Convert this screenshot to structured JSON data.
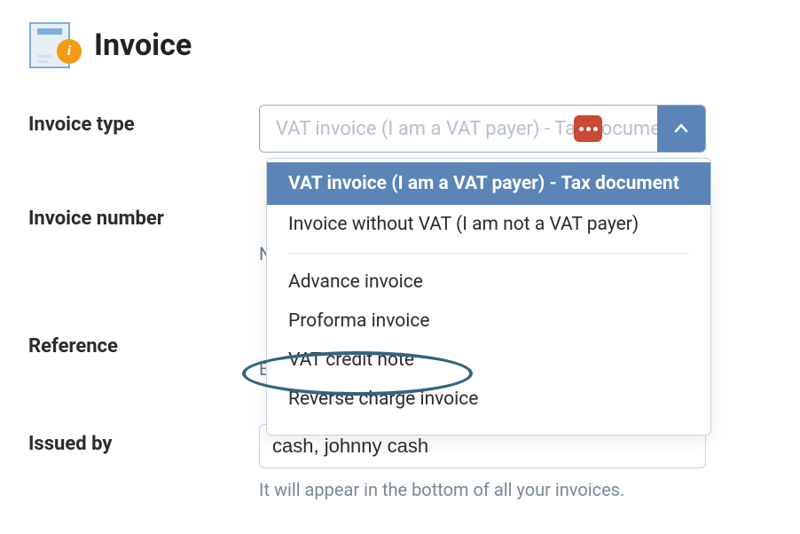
{
  "header": {
    "title": "Invoice",
    "info_badge_char": "i"
  },
  "rows": {
    "invoice_type_label": "Invoice type",
    "invoice_number_label": "Invoice number",
    "reference_label": "Reference",
    "issued_by_label": "Issued by"
  },
  "combo": {
    "placeholder": "VAT invoice (I am a VAT payer) - Tax document",
    "value": ""
  },
  "dropdown": {
    "items": [
      {
        "label": "VAT invoice (I am a VAT payer) - Tax document",
        "selected": true
      },
      {
        "label": "Invoice without VAT (I am not a VAT payer)",
        "selected": false
      }
    ],
    "secondary": [
      {
        "label": "Advance invoice"
      },
      {
        "label": "Proforma invoice"
      },
      {
        "label": "VAT credit note"
      },
      {
        "label": "Reverse charge invoice"
      }
    ]
  },
  "obscured": {
    "invoice_number_peek": "N",
    "reference_peek": "E"
  },
  "issued_by": {
    "value": "cash, johnny cash",
    "helper": "It will appear in the bottom of all your invoices."
  }
}
